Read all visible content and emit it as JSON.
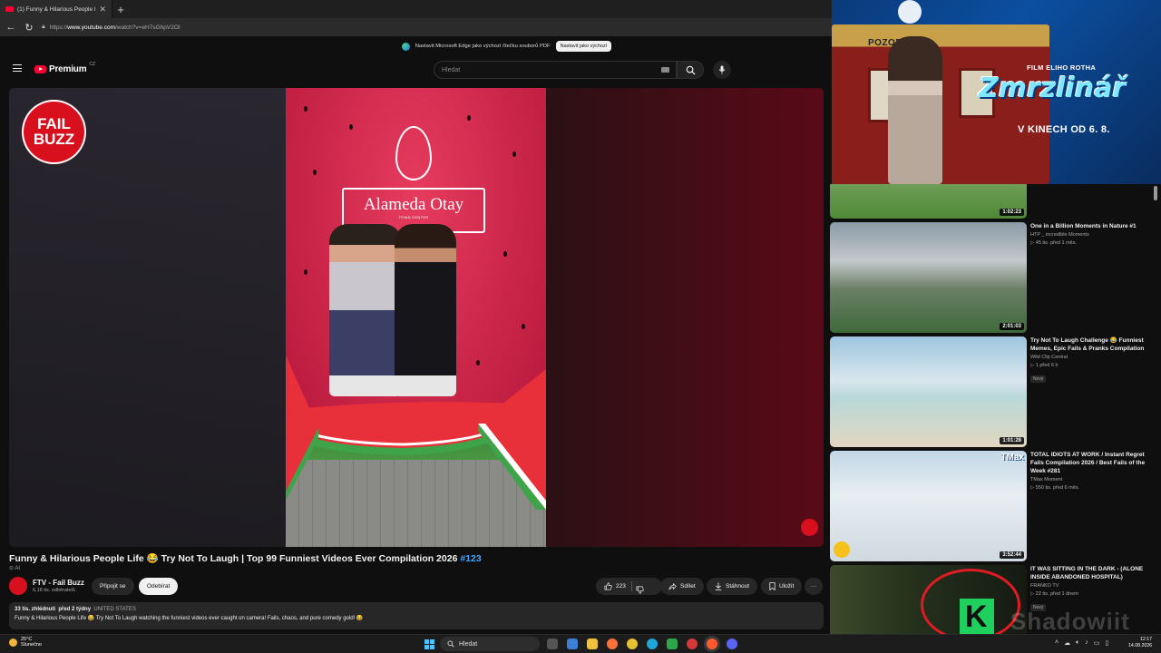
{
  "browser": {
    "tab_title": "(1) Funny & Hilarious People L",
    "url_prefix": "https://",
    "url_host": "www.youtube.com",
    "url_path": "/watch?v=eH7sGhpV2OI",
    "new_tab": "+",
    "close_tab": "✕"
  },
  "infobar": {
    "message": "Nastavit Microsoft Edge jako výchozí čtečku souborů PDF",
    "button": "Nastavit jako výchozí"
  },
  "youtube": {
    "logo_text": "Premium",
    "logo_country": "CZ",
    "search_placeholder": "Hledat"
  },
  "player": {
    "channel_logo_line1": "FAIL",
    "channel_logo_line2": "BUZZ",
    "sign_name": "Alameda Otay",
    "sign_sub": "TOWN CENTER"
  },
  "video": {
    "title": "Funny & Hilarious People Life 😂 Try Not To Laugh | Top 99 Funniest Videos Ever Compilation 2026 ",
    "hashtag": "#123",
    "ai_label": "AI",
    "channel_name": "FTV - Fail Buzz",
    "subscribers": "6,18 tis. odběratelů",
    "join_label": "Připojit se",
    "subscribe_label": "Odebírat",
    "likes": "223",
    "share_label": "Sdílet",
    "download_label": "Stáhnout",
    "save_label": "Uložit",
    "more_label": "···",
    "views": "33 tis. zhlédnutí",
    "date": "před 2 týdny",
    "location": "UNITED STATES",
    "description": "Funny & Hilarious People Life 😂 Try Not To Laugh watching the funniest videos ever caught on camera! Fails, chaos, and pure comedy gold! 😂"
  },
  "ad": {
    "poster_caption": "POZOR DĚTI",
    "film": "FILM ELIHO ROTHA",
    "title": "Zmrzlinář",
    "date": "V KINECH OD 6. 8."
  },
  "recommendations": [
    {
      "title": "",
      "channel": "",
      "meta": "",
      "duration": "1:02:23",
      "badge": ""
    },
    {
      "title": "One in a Billion Moments in Nature #1",
      "channel": "HTP _ incredible Moments",
      "meta": "▷ 45 tis.  před 1 měs.",
      "duration": "2:01:03",
      "badge": ""
    },
    {
      "title": "Try Not To Laugh Challenge 😂 Funniest Memes, Epic Fails & Pranks Compilation",
      "channel": "Wild Clip Central",
      "meta": "▷ 1  před 6 h",
      "duration": "1:01:28",
      "badge": "Nový"
    },
    {
      "title": "TOTAL IDIOTS AT WORK / Instant Regret Fails Compilation 2026 / Best Fails of the Week #281",
      "channel": "TMax Moment",
      "meta": "▷ 550 tis.  před 6 měs.",
      "duration": "3:52:44",
      "badge": ""
    },
    {
      "title": "IT WAS SITTING IN THE DARK - (ALONE INSIDE ABANDONED HOSPITAL)",
      "channel": "FRANKO TV",
      "meta": "▷ 22 tis.  před 1 dnem",
      "duration": "",
      "badge": "Nový"
    }
  ],
  "rec_overlay": {
    "tmax": "TMax"
  },
  "taskbar": {
    "temp": "25°C",
    "weather": "Slunečno",
    "search": "Hledat",
    "time": "12:17",
    "date": "14.08.2026"
  },
  "watermark": "Shadowiit",
  "colors": {
    "accent_red": "#ff0033",
    "link_blue": "#3ea6ff",
    "background": "#0f0f0f"
  }
}
